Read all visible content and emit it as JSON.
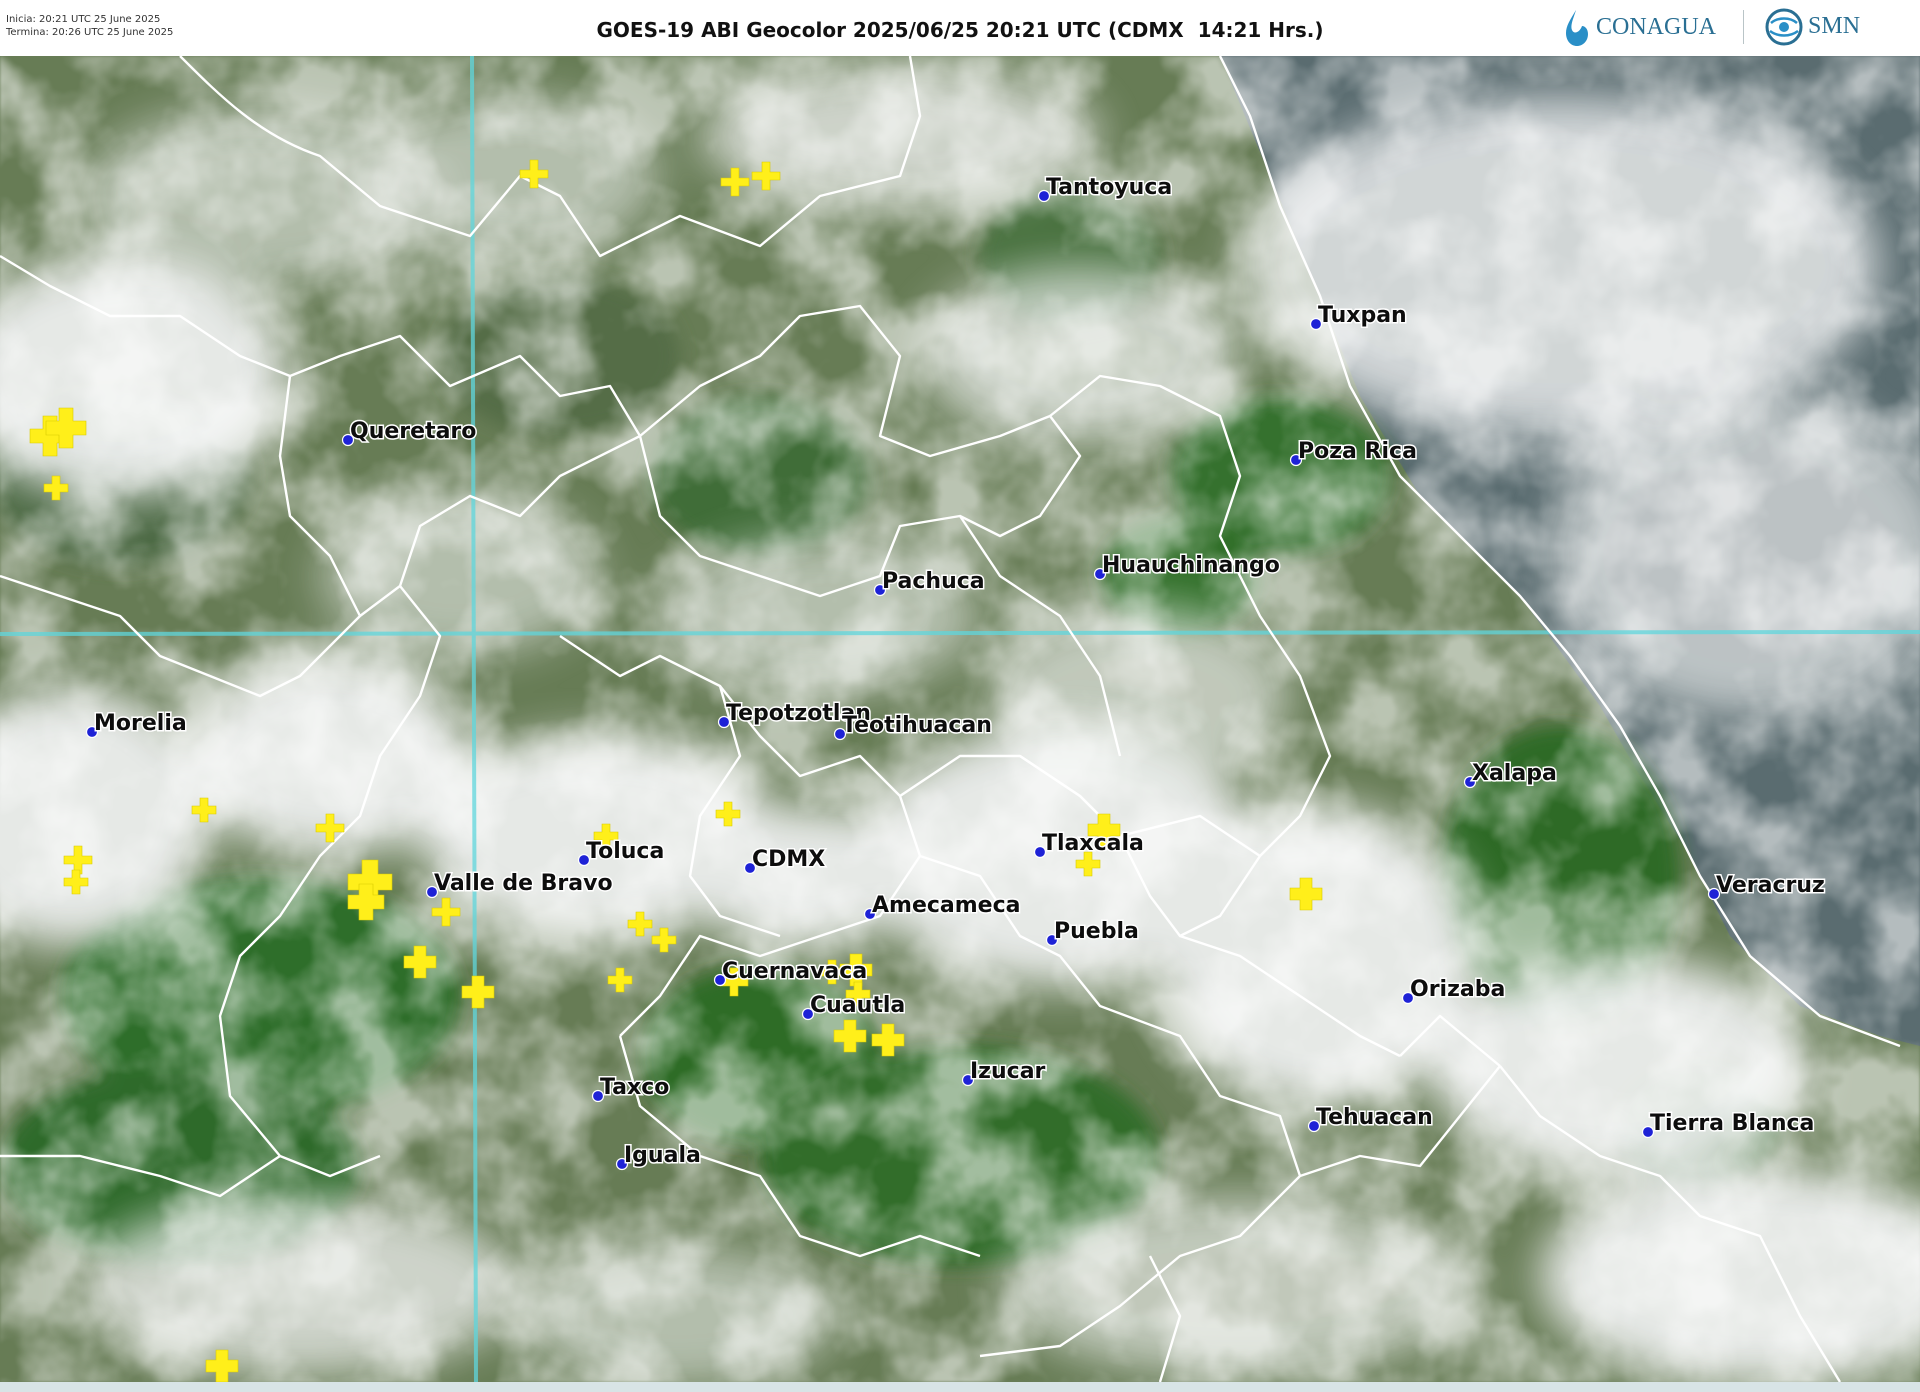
{
  "header": {
    "start_text": "Inicia: 20:21 UTC 25 June 2025",
    "end_text": "Termina: 20:26 UTC 25 June 2025",
    "title": "GOES-19 ABI Geocolor 2025/06/25 20:21 UTC (CDMX  14:21 Hrs.)",
    "logo_conagua": "CONAGUA",
    "logo_smn": "SMN"
  },
  "colors": {
    "city_dot": "#1e22d6",
    "lightning": "#ffef1a",
    "border": "#ffffff",
    "gridline": "#5fd6dc",
    "vegetation": "#2f6e2a",
    "gulf": "#5a6c70"
  },
  "icons": {
    "city_marker": "city-dot-icon",
    "lightning_marker": "lightning-cross-icon"
  },
  "cities": [
    {
      "id": "tantoyuca",
      "name": "Tantoyuca"
    },
    {
      "id": "tuxpan",
      "name": "Tuxpan"
    },
    {
      "id": "queretaro",
      "name": "Queretaro"
    },
    {
      "id": "poza-rica",
      "name": "Poza Rica"
    },
    {
      "id": "pachuca",
      "name": "Pachuca"
    },
    {
      "id": "huauchinango",
      "name": "Huauchinango"
    },
    {
      "id": "morelia",
      "name": "Morelia"
    },
    {
      "id": "tepotzotlan",
      "name": "Tepotzotlan"
    },
    {
      "id": "teotihuacan",
      "name": "Teotihuacan"
    },
    {
      "id": "xalapa",
      "name": "Xalapa"
    },
    {
      "id": "toluca",
      "name": "Toluca"
    },
    {
      "id": "cdmx",
      "name": "CDMX"
    },
    {
      "id": "tlaxcala",
      "name": "Tlaxcala"
    },
    {
      "id": "veracruz",
      "name": "Veracruz"
    },
    {
      "id": "valle-de-bravo",
      "name": "Valle de Bravo"
    },
    {
      "id": "amecameca",
      "name": "Amecameca"
    },
    {
      "id": "puebla",
      "name": "Puebla"
    },
    {
      "id": "cuernavaca",
      "name": "Cuernavaca"
    },
    {
      "id": "orizaba",
      "name": "Orizaba"
    },
    {
      "id": "cuautla",
      "name": "Cuautla"
    },
    {
      "id": "izucar",
      "name": "Izucar"
    },
    {
      "id": "taxco",
      "name": "Taxco"
    },
    {
      "id": "tehuacan",
      "name": "Tehuacan"
    },
    {
      "id": "tierra-blanca",
      "name": "Tierra Blanca"
    },
    {
      "id": "iguala",
      "name": "Iguala"
    }
  ]
}
